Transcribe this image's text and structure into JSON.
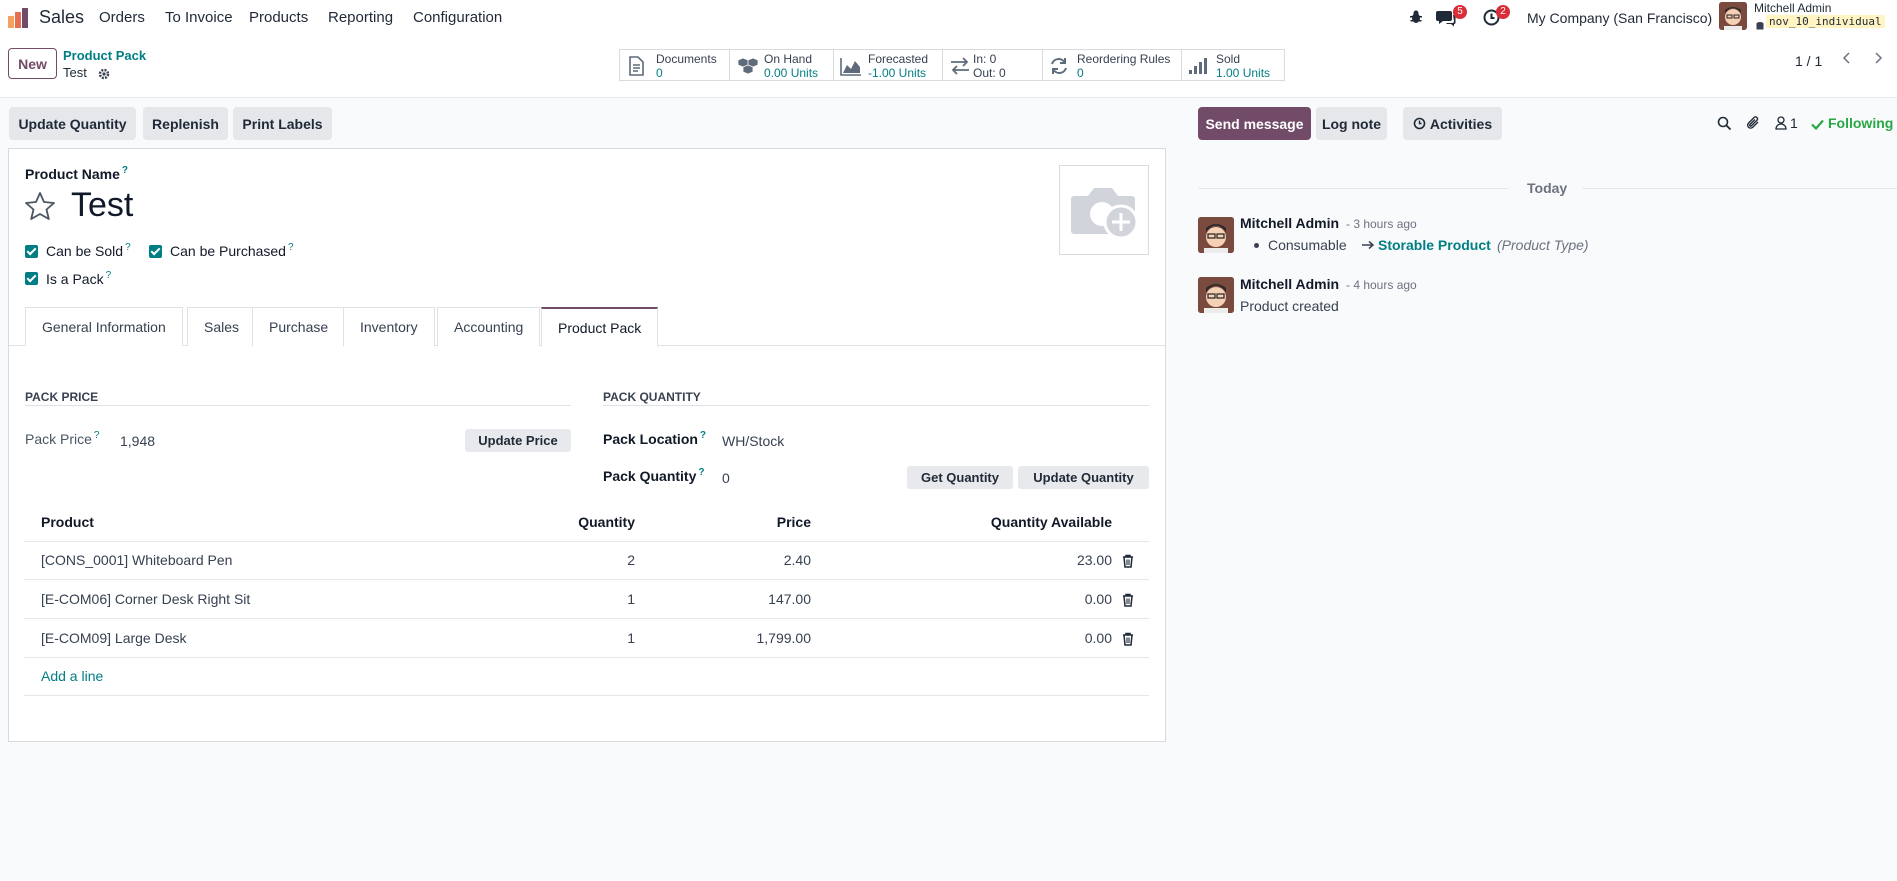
{
  "navbar": {
    "app_name": "Sales",
    "menu": [
      "Orders",
      "To Invoice",
      "Products",
      "Reporting",
      "Configuration"
    ],
    "messages_count": "5",
    "activities_count": "2",
    "company": "My Company (San Francisco)",
    "user_name": "Mitchell Admin",
    "db_name": "nov_10_individual"
  },
  "control": {
    "new_label": "New",
    "breadcrumb_parent": "Product Pack",
    "breadcrumb_current": "Test",
    "pager": "1 / 1",
    "stats": [
      {
        "label": "Documents",
        "value": "0",
        "icon": "document-icon"
      },
      {
        "label": "On Hand",
        "value": "0.00 Units",
        "icon": "cubes-icon"
      },
      {
        "label": "Forecasted",
        "value": "-1.00 Units",
        "icon": "area-chart-icon"
      },
      {
        "label": "In: 0",
        "value": "Out: 0",
        "icon": "exchange-icon"
      },
      {
        "label": "Reordering Rules",
        "value": "0",
        "icon": "refresh-icon"
      },
      {
        "label": "Sold",
        "value": "1.00 Units",
        "icon": "signal-icon"
      }
    ]
  },
  "actions": {
    "update_quantity": "Update Quantity",
    "replenish": "Replenish",
    "print_labels": "Print Labels"
  },
  "chatter": {
    "send_message": "Send message",
    "log_note": "Log note",
    "activities": "Activities",
    "followers_count": "1",
    "following": "Following",
    "date_separator": "Today",
    "messages": [
      {
        "author": "Mitchell Admin",
        "time": "- 3 hours ago",
        "old_value": "Consumable",
        "new_value": "Storable Product",
        "field": "(Product Type)"
      },
      {
        "author": "Mitchell Admin",
        "time": "- 4 hours ago",
        "body": "Product created"
      }
    ]
  },
  "form": {
    "product_name_label": "Product Name",
    "product_name": "Test",
    "can_be_sold": "Can be Sold",
    "can_be_purchased": "Can be Purchased",
    "is_a_pack": "Is a Pack",
    "tabs": [
      "General Information",
      "Sales",
      "Purchase",
      "Inventory",
      "Accounting",
      "Product Pack"
    ],
    "active_tab": "Product Pack",
    "pack_price_header": "PACK PRICE",
    "pack_price_label": "Pack Price",
    "pack_price_value": "1,948",
    "update_price": "Update Price",
    "pack_quantity_header": "PACK QUANTITY",
    "pack_location_label": "Pack Location",
    "pack_location_value": "WH/Stock",
    "pack_quantity_label": "Pack Quantity",
    "pack_quantity_value": "0",
    "get_quantity": "Get Quantity",
    "update_quantity": "Update Quantity",
    "table": {
      "columns": [
        "Product",
        "Quantity",
        "Price",
        "Quantity Available"
      ],
      "rows": [
        [
          "[CONS_0001] Whiteboard Pen",
          "2",
          "2.40",
          "23.00"
        ],
        [
          "[E-COM06] Corner Desk Right Sit",
          "1",
          "147.00",
          "0.00"
        ],
        [
          "[E-COM09] Large Desk",
          "1",
          "1,799.00",
          "0.00"
        ]
      ],
      "add_line": "Add a line"
    }
  },
  "colors": {
    "primary": "#714b67",
    "link": "#017e84",
    "badge": "#d92d3a",
    "following": "#28a745"
  }
}
